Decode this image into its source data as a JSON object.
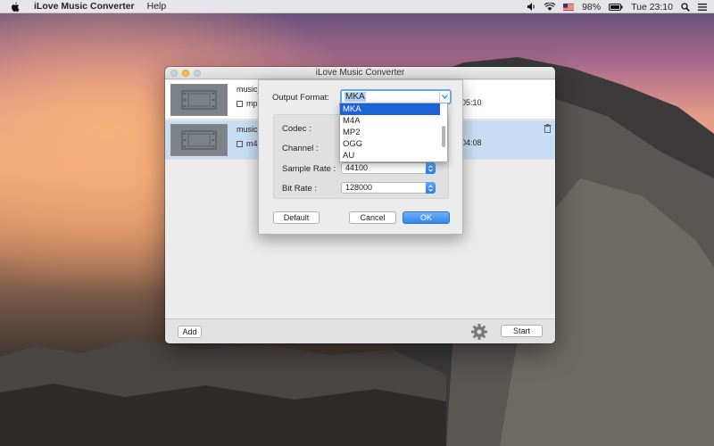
{
  "menubar": {
    "app_name": "iLove Music Converter",
    "help": "Help",
    "battery": "98%",
    "clock": "Tue 23:10",
    "icons": [
      "apple-icon",
      "volume-icon",
      "wifi-icon",
      "flag-icon",
      "battery-icon",
      "search-icon",
      "list-icon"
    ]
  },
  "window": {
    "title": "iLove Music Converter",
    "files": [
      {
        "name": "music_",
        "format": "mp3",
        "duration": "05:10"
      },
      {
        "name": "music_",
        "format": "m4a",
        "duration": "04:08"
      }
    ],
    "add_label": "Add",
    "start_label": "Start"
  },
  "dialog": {
    "output_format_label": "Output Format:",
    "output_format_value": "MKA",
    "codec_label": "Codec :",
    "channel_label": "Channel :",
    "sample_rate_label": "Sample Rate :",
    "sample_rate_value": "44100",
    "bit_rate_label": "Bit Rate :",
    "bit_rate_value": "128000",
    "default_label": "Default",
    "cancel_label": "Cancel",
    "ok_label": "OK"
  },
  "format_options": [
    "MKA",
    "M4A",
    "MP2",
    "OGG",
    "AU"
  ],
  "colors": {
    "accent": "#2f87ec",
    "selection_row": "#c8ddf3",
    "highlight": "#1d63d8"
  }
}
